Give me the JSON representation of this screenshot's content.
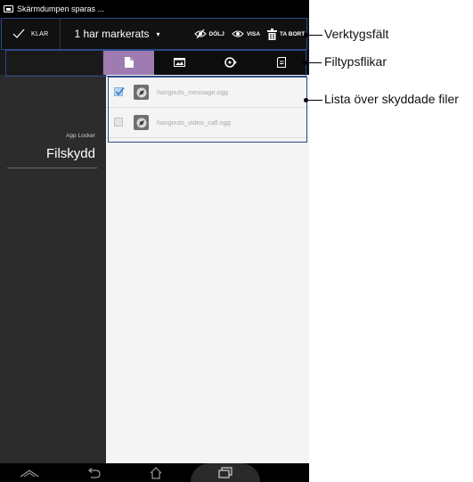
{
  "status_bar": {
    "text": "Skärmdumpen sparas ..."
  },
  "action_bar": {
    "done_label": "KLAR",
    "selection_label": "1 har markerats",
    "caret": "▾",
    "hide_label": "DÖLJ",
    "show_label": "VISA",
    "delete_label": "TA BORT"
  },
  "tabs": [
    {
      "icon": "document-icon",
      "active": true
    },
    {
      "icon": "image-icon",
      "active": false
    },
    {
      "icon": "music-icon",
      "active": false
    },
    {
      "icon": "file-icon",
      "active": false
    }
  ],
  "sidebar": {
    "app_name": "App Locker",
    "section": "Filskydd"
  },
  "files": [
    {
      "name": "hangouts_message.ogg",
      "checked": true
    },
    {
      "name": "hangouts_video_call.ogg",
      "checked": false
    }
  ],
  "callouts": {
    "toolbar": "Verktygsfält",
    "tabs": "Filtypsflikar",
    "list": "Lista över skyddade filer"
  },
  "colors": {
    "active_tab": "#9e7bb0",
    "callout_border": "#2b4a8a"
  }
}
